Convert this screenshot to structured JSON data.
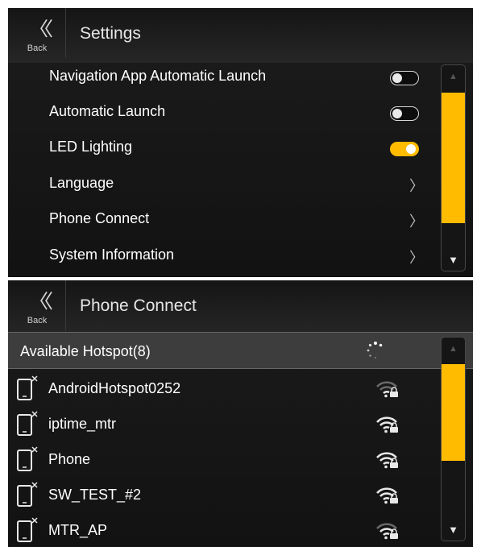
{
  "screen1": {
    "header": {
      "back_label": "Back",
      "title": "Settings"
    },
    "items": [
      {
        "label": "Navigation App Automatic Launch",
        "control": "toggle",
        "on": false
      },
      {
        "label": "Automatic Launch",
        "control": "toggle",
        "on": false
      },
      {
        "label": "LED Lighting",
        "control": "toggle",
        "on": true
      },
      {
        "label": "Language",
        "control": "chevron"
      },
      {
        "label": "Phone Connect",
        "control": "chevron"
      },
      {
        "label": "System Information",
        "control": "chevron"
      }
    ],
    "scrollbar": {
      "up_glyph": "▲",
      "down_glyph": "▼"
    }
  },
  "screen2": {
    "header": {
      "back_label": "Back",
      "title": "Phone Connect"
    },
    "section_title": "Available Hotspot(8)",
    "hotspots": [
      {
        "name": "AndroidHotspot0252",
        "signal": "weak",
        "secured": true
      },
      {
        "name": "iptime_mtr",
        "signal": "full",
        "secured": true
      },
      {
        "name": "Phone",
        "signal": "full",
        "secured": true
      },
      {
        "name": "SW_TEST_#2",
        "signal": "full",
        "secured": true
      },
      {
        "name": "MTR_AP",
        "signal": "medium",
        "secured": true
      }
    ],
    "scrollbar": {
      "up_glyph": "▲",
      "down_glyph": "▼"
    }
  },
  "icons": {
    "back": "double-chevron-left-icon",
    "chevron": "chevron-right-icon",
    "spinner": "loading-spinner-icon",
    "phone": "phone-disconnected-icon",
    "wifi": "wifi-lock-icon"
  },
  "colors": {
    "accent": "#ffbb00",
    "background": "#141414",
    "section_bar": "#3d3d3d"
  }
}
